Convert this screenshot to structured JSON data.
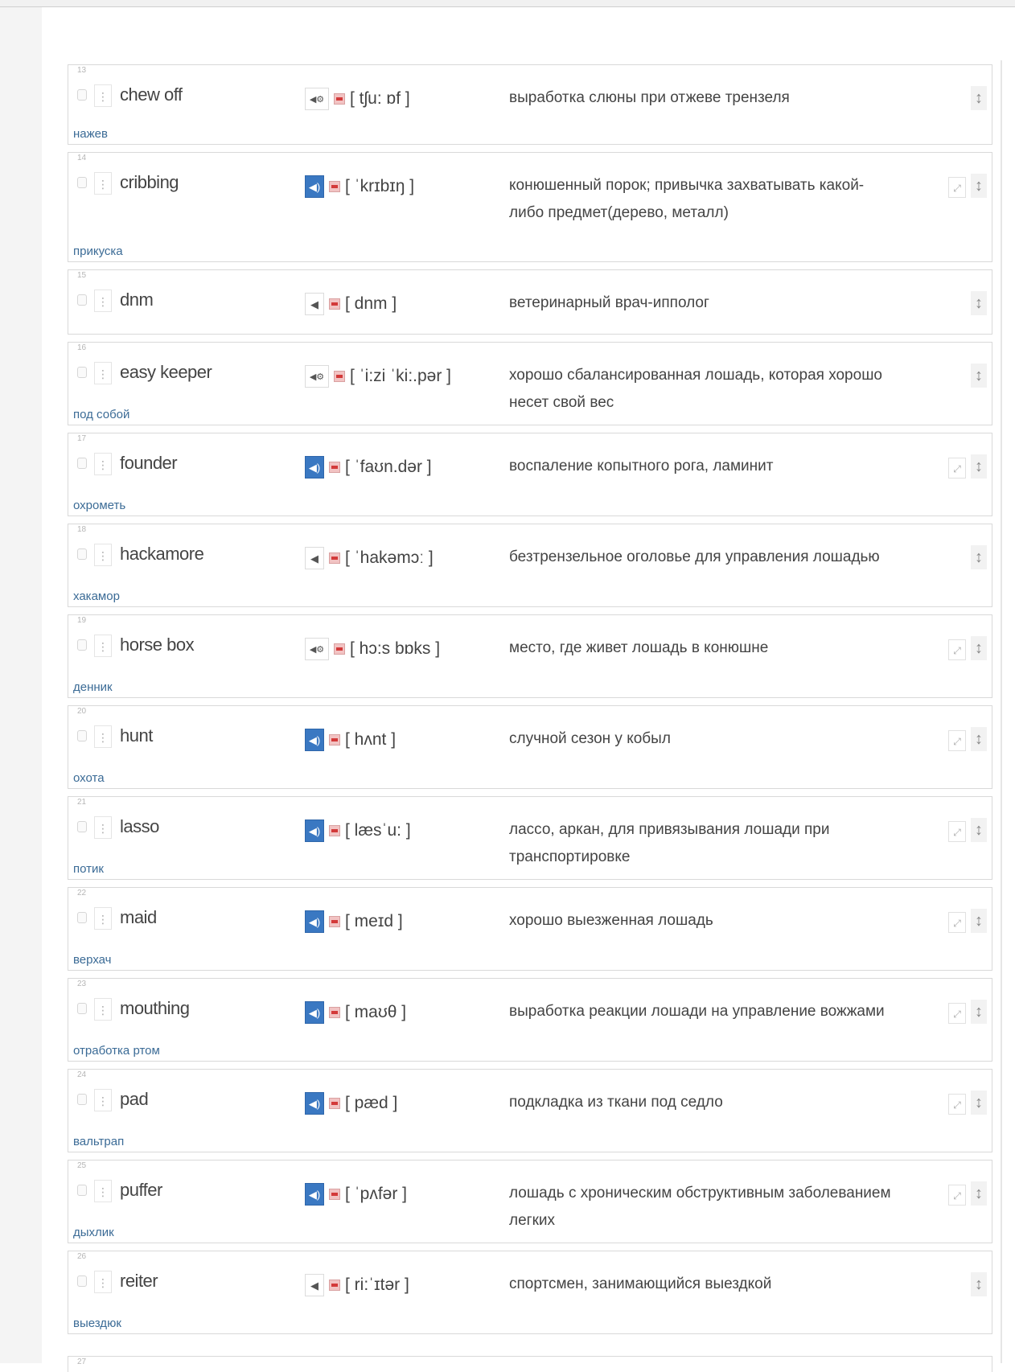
{
  "rows": [
    {
      "num": "13",
      "term": "chew off",
      "ipa": "[ tʃu: ɒf ]",
      "definition": "выработка слюны при отжеве трензеля",
      "translation": "нажев",
      "speaker": "gear",
      "edit": false,
      "height": 100
    },
    {
      "num": "14",
      "term": "cribbing",
      "ipa": "[ ˈkrɪbɪŋ ]",
      "definition": "конюшенный порок; привычка захватывать какой-либо предмет(дерево, металл)",
      "translation": "прикуска",
      "speaker": "blue",
      "edit": true,
      "height": 137
    },
    {
      "num": "15",
      "term": "dnm",
      "ipa": "[ dnm ]",
      "definition": "ветеринарный врач-ипполог",
      "translation": "",
      "speaker": "plain",
      "edit": false,
      "height": 81
    },
    {
      "num": "16",
      "term": "easy keeper",
      "ipa": "[ ˈi:zi ˈki:.pər ]",
      "definition": "хорошо сбалансированная лошадь, которая хорошо несет свой вес",
      "translation": "под собой",
      "speaker": "gear",
      "edit": false,
      "height": 104
    },
    {
      "num": "17",
      "term": "founder",
      "ipa": "[ ˈfaʊn.dər ]",
      "definition": "воспаление копытного рога, ламинит",
      "translation": "охрометь",
      "speaker": "blue",
      "edit": true,
      "height": 104
    },
    {
      "num": "18",
      "term": "hackamore",
      "ipa": "[ ˈhakəmɔː ]",
      "definition": "безтрензельное оголовье для управления лошадью",
      "translation": "хакамор",
      "speaker": "plain",
      "edit": false,
      "height": 104
    },
    {
      "num": "19",
      "term": "horse box",
      "ipa": "[ hɔ:s bɒks ]",
      "definition": "место, где живет лошадь в конюшне",
      "translation": "денник",
      "speaker": "gear",
      "edit": true,
      "height": 104
    },
    {
      "num": "20",
      "term": "hunt",
      "ipa": "[ hʌnt ]",
      "definition": "случной сезон у кобыл",
      "translation": "охота",
      "speaker": "blue",
      "edit": true,
      "height": 104
    },
    {
      "num": "21",
      "term": "lasso",
      "ipa": "[ læsˈu: ]",
      "definition": "лассо, аркан, для привязывания лошади при транспортировке",
      "translation": "потик",
      "speaker": "blue",
      "edit": true,
      "height": 104
    },
    {
      "num": "22",
      "term": "maid",
      "ipa": "[ meɪd ]",
      "definition": "хорошо выезженная лошадь",
      "translation": "верхач",
      "speaker": "blue",
      "edit": true,
      "height": 104
    },
    {
      "num": "23",
      "term": "mouthing",
      "ipa": "[ maʊθ ]",
      "definition": "выработка реакции лошади на управление вожжами",
      "translation": "отработка ртом",
      "speaker": "blue",
      "edit": true,
      "height": 104
    },
    {
      "num": "24",
      "term": "pad",
      "ipa": "[ pæd ]",
      "definition": "подкладка из ткани под седло",
      "translation": "вальтрап",
      "speaker": "blue",
      "edit": true,
      "height": 104
    },
    {
      "num": "25",
      "term": "puffer",
      "ipa": "[ ˈpʌfər ]",
      "definition": "лошадь с хроническим обструктивным заболеванием легких",
      "translation": "дыхлик",
      "speaker": "blue",
      "edit": true,
      "height": 104
    },
    {
      "num": "26",
      "term": "reiter",
      "ipa": "[ ri:ˈɪtər ]",
      "definition": "спортсмен, занимающийся выездкой",
      "translation": "выездюк",
      "speaker": "plain",
      "edit": false,
      "height": 104
    }
  ],
  "partial_row": {
    "num": "27"
  },
  "icons": {
    "speaker": "speaker-icon",
    "flag": "flag-icon",
    "drag": "drag-handle-icon",
    "edit": "edit-icon",
    "move": "move-vertical-icon",
    "accent": "#3a78c2"
  }
}
